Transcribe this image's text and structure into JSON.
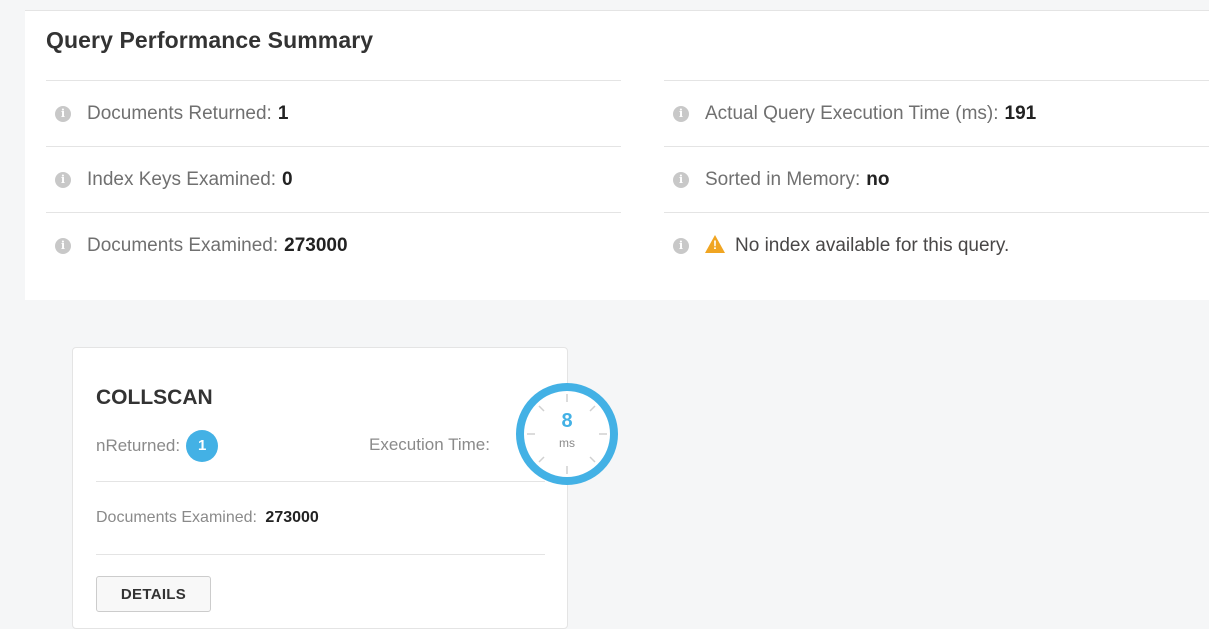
{
  "summary": {
    "title": "Query Performance Summary",
    "left": [
      {
        "label": "Documents Returned:",
        "value": "1"
      },
      {
        "label": "Index Keys Examined:",
        "value": "0"
      },
      {
        "label": "Documents Examined:",
        "value": "273000"
      }
    ],
    "right": [
      {
        "label": "Actual Query Execution Time (ms):",
        "value": "191"
      },
      {
        "label": "Sorted in Memory:",
        "value": "no"
      },
      {
        "label": "No index available for this query.",
        "value": ""
      }
    ],
    "info_icon": "info-icon",
    "warning_icon": "warning-icon",
    "colors": {
      "warning": "#f0a522",
      "info": "#c8c8c8"
    }
  },
  "stage": {
    "name": "COLLSCAN",
    "nreturned_label": "nReturned:",
    "nreturned_value": "1",
    "exec_time_label": "Execution Time:",
    "exec_time_value": "8",
    "exec_time_unit": "ms",
    "docs_examined_label": "Documents Examined:",
    "docs_examined_value": "273000",
    "details_label": "DETAILS",
    "accent": "#43b1e5"
  }
}
